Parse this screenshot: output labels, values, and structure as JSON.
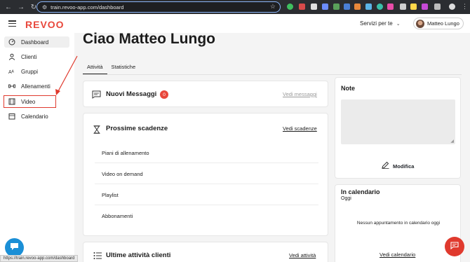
{
  "browser": {
    "url": "train.revoo-app.com/dashboard",
    "status_url": "https://train.revoo-app.com/dashboard"
  },
  "header": {
    "brand": "REVOO",
    "services_label": "Servizi per te",
    "user_name": "Matteo Lungo"
  },
  "sidebar": {
    "items": [
      {
        "label": "Dashboard",
        "icon": "gauge-icon",
        "active": true
      },
      {
        "label": "Clienti",
        "icon": "user-icon"
      },
      {
        "label": "Gruppi",
        "icon": "group-icon"
      },
      {
        "label": "Allenamenti",
        "icon": "dumbbell-icon"
      },
      {
        "label": "Video",
        "icon": "film-icon"
      },
      {
        "label": "Calendario",
        "icon": "calendar-icon"
      }
    ],
    "highlight_color": "#e03a2e"
  },
  "main": {
    "greeting": "Ciao Matteo Lungo",
    "tabs": [
      "Attività",
      "Statistiche"
    ]
  },
  "messages_card": {
    "title": "Nuovi Messaggi",
    "count": "0",
    "link": "Vedi messaggi"
  },
  "deadlines_card": {
    "title": "Prossime scadenze",
    "link": "Vedi scadenze",
    "rows": [
      "Piani di allenamento",
      "Video on demand",
      "Playlist",
      "Abbonamenti"
    ]
  },
  "activity_card": {
    "title": "Ultime attività clienti",
    "link": "Vedi attività"
  },
  "notes_card": {
    "title": "Note",
    "edit_label": "Modifica"
  },
  "calendar_card": {
    "title": "In calendario",
    "subtitle": "Oggi",
    "empty_text": "Nessun appuntamento in calendario oggi",
    "link": "Vedi calendario"
  },
  "colors": {
    "brand": "#e8473b",
    "accent": "#e03a2e",
    "chat": "#1b8fd6"
  }
}
